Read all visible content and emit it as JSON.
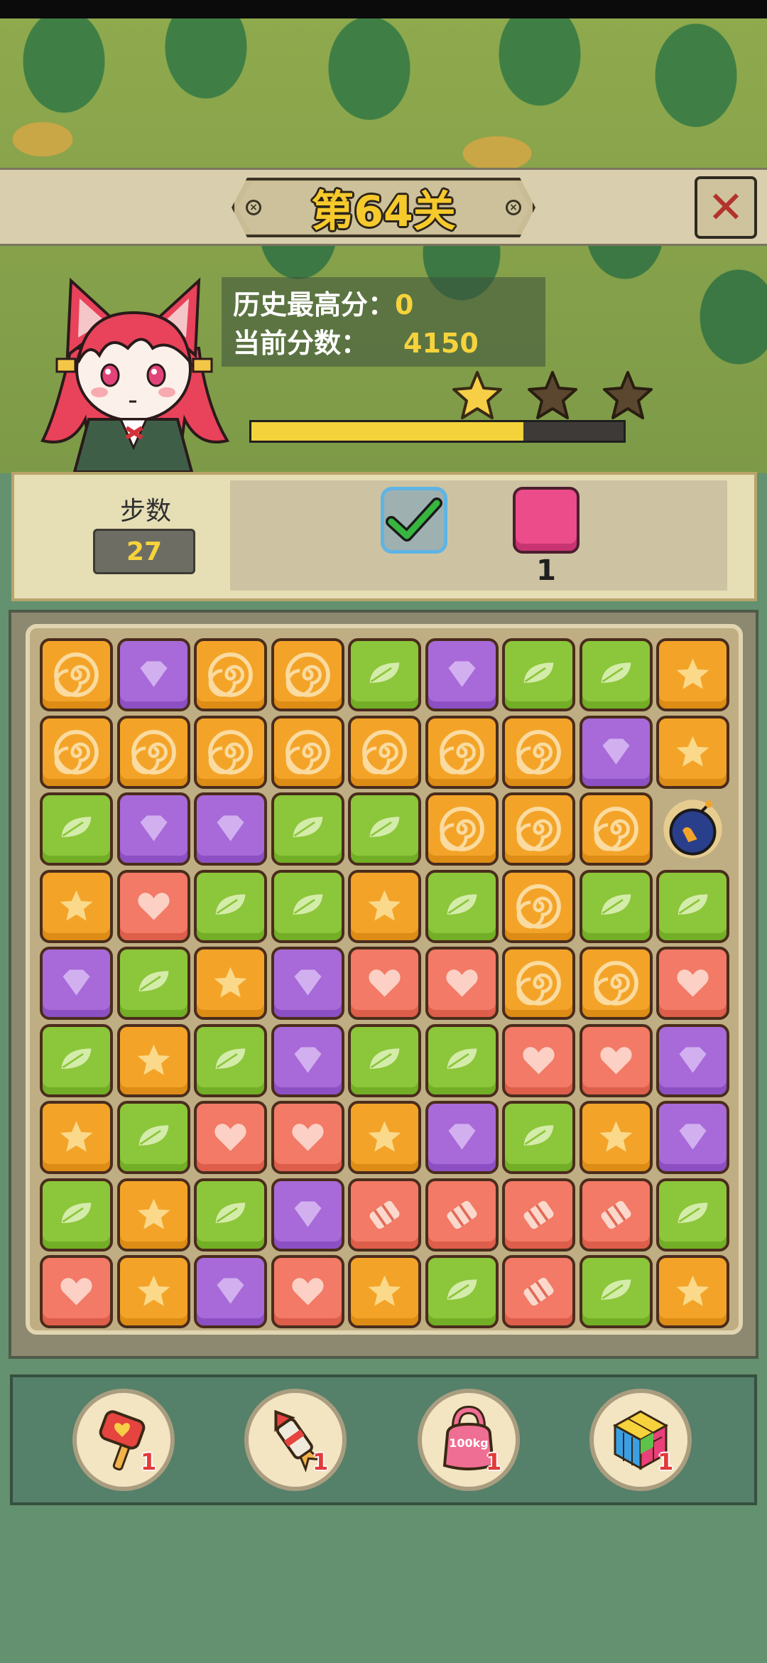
{
  "header": {
    "level_title": "第64关",
    "close_label": "✕"
  },
  "scores": {
    "best_label": "历史最高分：",
    "best_value": "0",
    "current_label": "当前分数：",
    "current_value": "4150",
    "stars_earned": 1,
    "stars_total": 3,
    "progress_fraction": 0.73
  },
  "goals": {
    "steps_label": "步数",
    "steps_value": "27",
    "items": [
      {
        "icon": "green-checkmark-icon",
        "status": "completed"
      },
      {
        "icon": "pink-block-icon",
        "count": "1"
      }
    ]
  },
  "board": {
    "rows": [
      [
        "O",
        "P",
        "O",
        "O",
        "G",
        "P",
        "G",
        "G",
        "Y"
      ],
      [
        "O",
        "O",
        "O",
        "O",
        "O",
        "O",
        "O",
        "P",
        "Y"
      ],
      [
        "G",
        "P",
        "P",
        "G",
        "G",
        "O",
        "O",
        "O",
        "B"
      ],
      [
        "Y",
        "R",
        "G",
        "G",
        "Y",
        "G",
        "O",
        "G",
        "G"
      ],
      [
        "P",
        "G",
        "Y",
        "P",
        "R",
        "R",
        "O",
        "O",
        "R"
      ],
      [
        "G",
        "Y",
        "G",
        "P",
        "G",
        "G",
        "R",
        "R",
        "P"
      ],
      [
        "Y",
        "G",
        "R",
        "R",
        "Y",
        "P",
        "G",
        "Y",
        "P"
      ],
      [
        "G",
        "Y",
        "G",
        "P",
        "C",
        "C",
        "C",
        "C",
        "G"
      ],
      [
        "R",
        "Y",
        "P",
        "R",
        "Y",
        "G",
        "C",
        "G",
        "Y"
      ]
    ],
    "legend": {
      "O": "orange-swirl",
      "P": "purple-gem",
      "G": "green-leaf",
      "Y": "yellow-star",
      "R": "red-heart",
      "C": "candy-block",
      "B": "bomb"
    }
  },
  "boosters": [
    {
      "name": "hammer-booster",
      "count": "1"
    },
    {
      "name": "rocket-booster",
      "count": "1"
    },
    {
      "name": "weight-booster",
      "count": "1",
      "label": "100kg"
    },
    {
      "name": "rainbow-cube-booster",
      "count": "1"
    }
  ]
}
